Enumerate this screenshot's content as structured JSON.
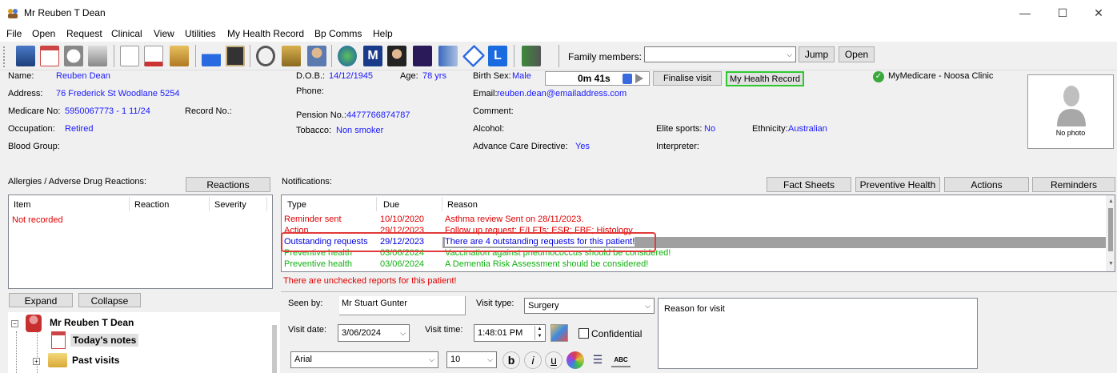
{
  "window": {
    "title": "Mr Reuben T Dean",
    "minimize": "—",
    "maximize": "☐",
    "close": "✕"
  },
  "menu": [
    "File",
    "Open",
    "Request",
    "Clinical",
    "View",
    "Utilities",
    "My Health Record",
    "Bp Comms",
    "Help"
  ],
  "toolbar": {
    "family_label": "Family members:",
    "family_value": "",
    "jump": "Jump",
    "open": "Open",
    "icons": [
      "cabinet-icon",
      "calendar-icon",
      "clock-icon",
      "printer-icon",
      "blank-page-icon",
      "prescription-icon",
      "hourglass-icon",
      "flask-icon",
      "xray-icon",
      "stethoscope-icon",
      "scales-icon",
      "doctor-icon",
      "globe-icon",
      "m-letter-icon",
      "graduate-icon",
      "dna-icon",
      "document-stack-icon",
      "diamond-icon",
      "l-letter-icon",
      "exit-icon"
    ]
  },
  "patient": {
    "name_label": "Name:",
    "name": "Reuben Dean",
    "address_label": "Address:",
    "address": "76 Frederick St  Woodlane  5254",
    "medicare_label": "Medicare No:",
    "medicare": "5950067773 - 1  11/24",
    "record_label": "Record No.:",
    "occupation_label": "Occupation:",
    "occupation": "Retired",
    "blood_label": "Blood Group:",
    "dob_label": "D.O.B.:",
    "dob": "14/12/1945",
    "age_label": "Age:",
    "age": "78 yrs",
    "phone_label": "Phone:",
    "pension_label": "Pension No.:",
    "pension": "4477766874787",
    "tobacco_label": "Tobacco:",
    "tobacco": "Non smoker",
    "sex_label": "Birth Sex:",
    "sex": "Male",
    "email_label": "Email:",
    "email": "reuben.dean@emailaddress.com",
    "comment_label": "Comment:",
    "alcohol_label": "Alcohol:",
    "acd_label": "Advance Care Directive:",
    "acd": "Yes",
    "elite_label": "Elite sports:",
    "elite": "No",
    "ethnicity_label": "Ethnicity:",
    "ethnicity": "Australian",
    "interpreter_label": "Interpreter:",
    "timer": "0m  41s",
    "finalise": "Finalise visit",
    "mhr": "My Health Record",
    "medicare_status": "MyMedicare - Noosa Clinic",
    "no_photo": "No photo"
  },
  "allergies": {
    "title": "Allergies / Adverse Drug Reactions:",
    "reactions_btn": "Reactions",
    "cols": [
      "Item",
      "Reaction",
      "Severity"
    ],
    "empty": "Not recorded",
    "expand": "Expand",
    "collapse": "Collapse"
  },
  "tree": {
    "patient": "Mr Reuben T Dean",
    "today": "Today's notes",
    "past": "Past visits"
  },
  "notifications": {
    "title": "Notifications:",
    "buttons": [
      "Fact Sheets",
      "Preventive Health",
      "Actions",
      "Reminders"
    ],
    "cols": [
      "Type",
      "Due",
      "Reason"
    ],
    "rows": [
      {
        "type": "Reminder sent",
        "due": "10/10/2020",
        "reason": "Asthma review    Sent on 28/11/2023.",
        "color": "#e00000"
      },
      {
        "type": "Action",
        "due": "29/12/2023",
        "reason": "Follow up request: E/LFTs; ESR; FBE; Histology",
        "color": "#e00000"
      },
      {
        "type": "Outstanding requests",
        "due": "29/12/2023",
        "reason": "There are 4 outstanding requests for this patient!",
        "color": "#0000e0"
      },
      {
        "type": "Preventive health",
        "due": "03/06/2024",
        "reason": "Vaccination against pneumococcus should be considered!",
        "color": "#12b012"
      },
      {
        "type": "Preventive health",
        "due": "03/06/2024",
        "reason": "A Dementia Risk Assessment should be considered!",
        "color": "#12b012"
      }
    ],
    "unchecked": "There are unchecked reports for this patient!"
  },
  "visit": {
    "seen_by_label": "Seen by:",
    "seen_by": "Mr Stuart Gunter",
    "visit_type_label": "Visit type:",
    "visit_type": "Surgery",
    "reason_placeholder": "Reason for visit",
    "visit_date_label": "Visit date:",
    "visit_date": "3/06/2024",
    "visit_time_label": "Visit time:",
    "visit_time": "1:48:01 PM",
    "confidential": "Confidential",
    "font": "Arial",
    "size": "10"
  },
  "colors": {
    "link": "#1a1aff",
    "alert": "#e00000",
    "ok": "#12b012",
    "highlight": "#e23a3a",
    "selection": "#a0a0a0"
  }
}
